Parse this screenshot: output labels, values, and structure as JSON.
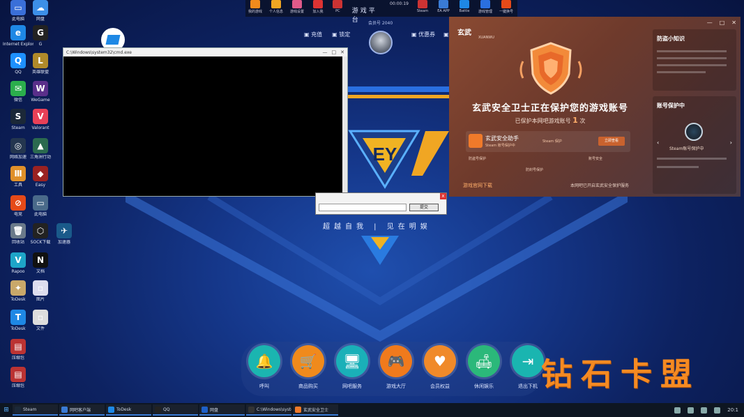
{
  "toolbar": {
    "title": "游戏平台",
    "items_left": [
      "我的游戏",
      "个人信息",
      "游戏设置",
      "加入我"
    ],
    "item_pc": "PC",
    "items_right": [
      "Steam",
      "EA APP",
      "Battle",
      "游戏管理",
      "一键换号"
    ],
    "timer": "00:00:19"
  },
  "desktop_icons": [
    {
      "label": "此电脑",
      "color": "#3a6fd8",
      "glyph": "▭"
    },
    {
      "label": "网盘",
      "color": "#3c8fe8",
      "glyph": "☁"
    },
    {
      "label": "Internet Explorer",
      "color": "#1e88e5",
      "glyph": "e"
    },
    {
      "label": "G",
      "color": "#222",
      "glyph": "G"
    },
    {
      "label": "QQ",
      "color": "#1e90ff",
      "glyph": "Q"
    },
    {
      "label": "英雄联盟",
      "color": "#b08a2a",
      "glyph": "L"
    },
    {
      "label": "微信",
      "color": "#2bae4c",
      "glyph": "✉"
    },
    {
      "label": "WeGame",
      "color": "#5a2f8a",
      "glyph": "W"
    },
    {
      "label": "Steam",
      "color": "#1b2838",
      "glyph": "S"
    },
    {
      "label": "Valorant",
      "color": "#e84057",
      "glyph": "V"
    },
    {
      "label": "网络加速",
      "color": "#24364f",
      "glyph": "◎"
    },
    {
      "label": "三角洲行动",
      "color": "#2b6a4f",
      "glyph": "▲"
    },
    {
      "label": "工具",
      "color": "#e0902a",
      "glyph": "Ⅲ"
    },
    {
      "label": "Easy",
      "color": "#9a2222",
      "glyph": "◆"
    },
    {
      "label": "电竞",
      "color": "#e64a19",
      "glyph": "⊘"
    },
    {
      "label": "此电脑",
      "color": "#4a6a8a",
      "glyph": "▭"
    },
    {
      "label": "回收站",
      "color": "#6a7a8a",
      "glyph": "🗑"
    },
    {
      "label": "SOCK下载",
      "color": "#222",
      "glyph": "⬡"
    },
    {
      "label": "加速器",
      "color": "#1a5a8a",
      "glyph": "✈"
    },
    {
      "label": "Rapoo",
      "color": "#1ea5c8",
      "glyph": "V"
    },
    {
      "label": "文档",
      "color": "#111",
      "glyph": "N"
    },
    {
      "label": "ToDesk",
      "color": "#c9a86a",
      "glyph": "✦"
    },
    {
      "label": "图片",
      "color": "#dde",
      "glyph": "▫"
    },
    {
      "label": "ToDesk",
      "color": "#1e88e5",
      "glyph": "T"
    },
    {
      "label": "文件",
      "color": "#ddd",
      "glyph": "▫"
    },
    {
      "label": "压缩包",
      "color": "#b33",
      "glyph": "▤"
    },
    {
      "label": "压缩包",
      "color": "#b33",
      "glyph": "▤"
    }
  ],
  "game": {
    "nav_left": [
      "充值",
      "锁定"
    ],
    "user_id": "会员号 2040",
    "nav_right": [
      "优惠券",
      "付"
    ],
    "slogan": "超越自我 | 见在明娱"
  },
  "console": {
    "title": "C:\\Windows\\system32\\cmd.exe"
  },
  "mini_dialog": {
    "button": "提交",
    "close": "x"
  },
  "xuanwu": {
    "logo": "玄武",
    "logo_sub": "XUANWU",
    "headline": "玄武安全卫士正在保护您的游戏账号",
    "sub_prefix": "已保护本网吧游戏账号",
    "count": "1",
    "sub_suffix": "次",
    "card_name": "玄武安全助手",
    "card_status": "Steam 账号保护中",
    "card_status2": "Steam 保护",
    "card_button": "立即查看",
    "features": [
      "防盗号保护",
      "防封号保护",
      "账号安全"
    ],
    "bottom_left": "游戏官网下载",
    "bottom_right": "本网吧已开启玄武安全保护服务",
    "side1_title": "防盗小知识",
    "side2_title": "账号保护中",
    "side2_account": "Steam账号保护中",
    "win_controls": [
      "—",
      "□",
      "✕"
    ]
  },
  "dock": [
    {
      "label": "呼叫",
      "color": "#1bb5b0",
      "glyph": "🔔"
    },
    {
      "label": "商品购买",
      "color": "#f08a1c",
      "glyph": "🛒"
    },
    {
      "label": "网吧服务",
      "color": "#1ab0b8",
      "glyph": "🖥"
    },
    {
      "label": "游戏大厅",
      "color": "#f07a1c",
      "glyph": "🎮"
    },
    {
      "label": "会员权益",
      "color": "#f08a2a",
      "glyph": "♥"
    },
    {
      "label": "休闲娱乐",
      "color": "#2bb87a",
      "glyph": "🛋"
    },
    {
      "label": "退出下机",
      "color": "#1ab5b0",
      "glyph": "⇥"
    }
  ],
  "watermark": "钻石卡盟",
  "taskbar": {
    "tasks": [
      {
        "label": "Steam",
        "color": "#1b2838"
      },
      {
        "label": "网吧客户端",
        "color": "#3a7bd5"
      },
      {
        "label": "ToDesk",
        "color": "#1e88e5"
      },
      {
        "label": "QQ",
        "color": "#222"
      },
      {
        "label": "网盘",
        "color": "#1e60c8"
      },
      {
        "label": "C:\\Windows\\system32",
        "color": "#333"
      },
      {
        "label": "玄武安全卫士",
        "color": "#f07a2a"
      }
    ],
    "time": "20:1"
  }
}
